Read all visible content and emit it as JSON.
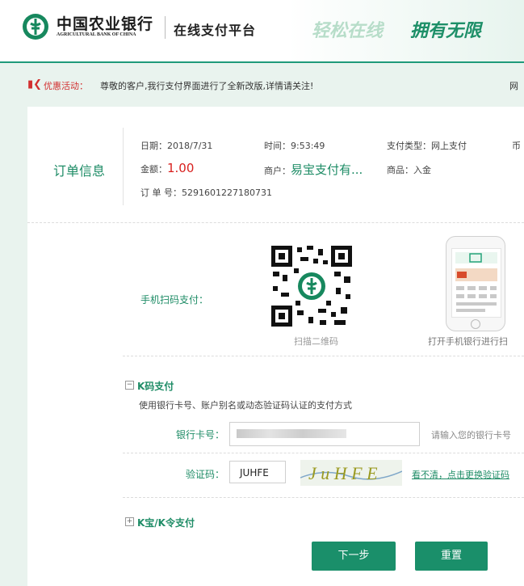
{
  "header": {
    "bank_name_cn": "中国农业银行",
    "bank_name_en": "AGRICULTURAL BANK OF CHINA",
    "platform": "在线支付平台",
    "slogan_part1": "轻松在线",
    "slogan_part2": "拥有无限",
    "brand_color": "#17885e"
  },
  "notice": {
    "label": "优惠活动：",
    "text": "尊敬的客户,我行支付界面进行了全新改版,详情请关注!",
    "right_text": "网"
  },
  "order": {
    "title": "订单信息",
    "date": "日期：2018/7/31",
    "time": "时间：9:53:49",
    "pay_type": "支付类型：网上支付",
    "extra": "币",
    "amount_label": "金额：",
    "amount_value": "1.00",
    "merchant_label": "商户：",
    "merchant_value": "易宝支付有...",
    "goods": "商品：入金",
    "order_no": "订 单 号：5291601227180731"
  },
  "scan": {
    "label": "手机扫码支付：",
    "qr_caption": "扫描二维码",
    "phone_caption": "打开手机银行进行扫"
  },
  "kcode": {
    "toggle": "−",
    "title": "K码支付",
    "desc": "使用银行卡号、账户别名或动态验证码认证的支付方式",
    "card_label": "银行卡号：",
    "card_hint": "请输入您的银行卡号",
    "captcha_label": "验证码：",
    "captcha_value": "JUHFE",
    "captcha_image_text": "J u H F E",
    "captcha_link": "看不清，点击更换验证码"
  },
  "kbao": {
    "toggle": "+",
    "title": "K宝/K令支付"
  },
  "buttons": {
    "next": "下一步",
    "reset": "重置"
  }
}
